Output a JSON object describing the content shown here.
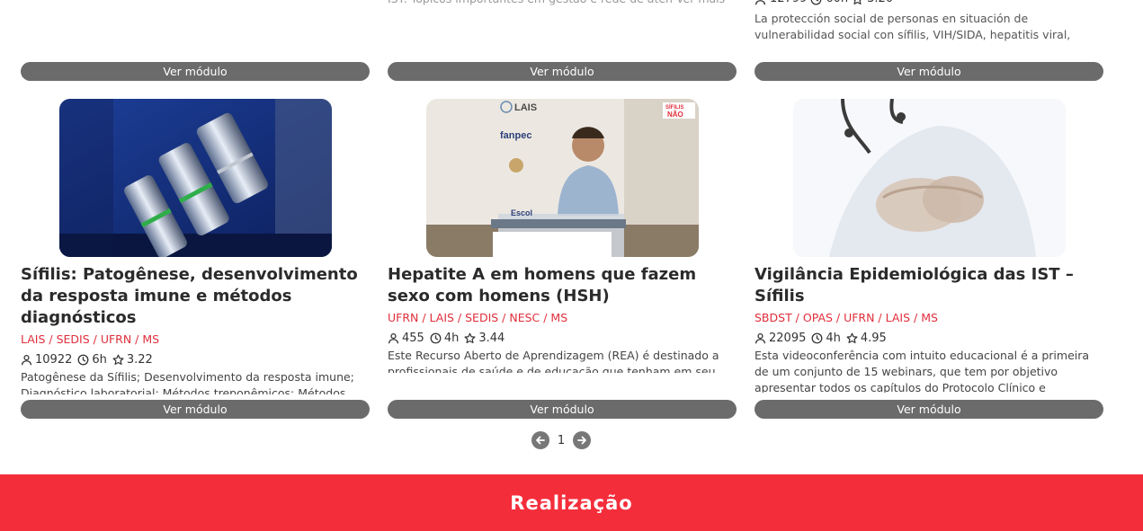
{
  "top_row": {
    "col2_fragment": "IST. Tópicos importantes em gestão e rede de aten Ver mais",
    "col3_stats": {
      "enrollments": "12799",
      "hours": "60h",
      "rating": "3.20"
    },
    "col3_description": "La protección social de personas en situación de vulnerabilidad social con sífilis, VIH/SIDA, hepatitis viral, tuberculosis o lepra es el"
  },
  "button_label": "Ver módulo",
  "cards": [
    {
      "title": "Sífilis: Patogênese, desenvolvimento da resposta imune e métodos diagnósticos",
      "partners": "LAIS / SEDIS / UFRN / MS",
      "enrollments": "10922",
      "hours": "6h",
      "rating": "3.22",
      "description": "Patogênese da Sífilis; Desenvolvimento da resposta imune; Diagnóstico laboratorial: Métodos treponêmicos; Métodos não-"
    },
    {
      "title": "Hepatite A em homens que fazem sexo com homens (HSH)",
      "partners": "UFRN / LAIS / SEDIS / NESC / MS",
      "enrollments": "455",
      "hours": "4h",
      "rating": "3.44",
      "description": "Este Recurso Aberto de Aprendizagem (REA) é destinado a profissionais de saúde e de educação que tenham em seu fazer",
      "image_text": {
        "lais": "LAIS",
        "fanpec": "fanpec",
        "sifilis_nao_top": "SÍFILIS",
        "sifilis_nao_bottom": "NÃO",
        "podium": "Escol"
      }
    },
    {
      "title": "Vigilância Epidemiológica das IST – Sífilis",
      "partners": "SBDST / OPAS / UFRN / LAIS / MS",
      "enrollments": "22095",
      "hours": "4h",
      "rating": "4.95",
      "description": "Esta videoconferência com intuito educacional é a primeira de um conjunto de 15 webinars, que tem por objetivo apresentar todos os capítulos do Protocolo Clínico e Diretrizes Terapêuticas (PCDT) do"
    }
  ],
  "pagination": {
    "current_page": "1"
  },
  "footer": {
    "title": "Realização"
  },
  "colors": {
    "accent": "#f42d3b",
    "button": "#6b6b6b",
    "partners": "#e02f3c"
  }
}
